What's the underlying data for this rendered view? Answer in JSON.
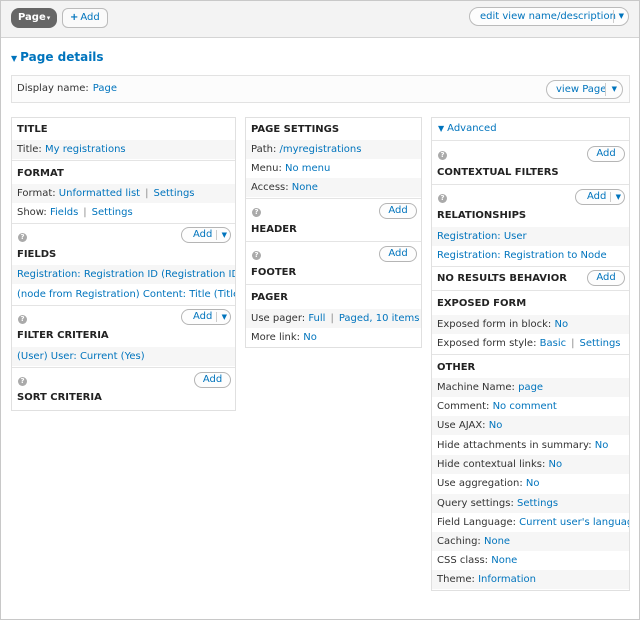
{
  "topbar": {
    "display_tab": "Page",
    "display_tab_caret": "▾",
    "add_display_icon": "+",
    "add_display": "Add",
    "edit_view_name": "edit view name/description",
    "dropdown_icon": "▼"
  },
  "details": {
    "toggle": "Page details",
    "toggle_icon": "▼",
    "display_name_label": "Display name:",
    "display_name_value": "Page",
    "view_page": "view Page"
  },
  "col1": {
    "title": {
      "heading": "TITLE",
      "label": "Title:",
      "value": "My registrations"
    },
    "format": {
      "heading": "FORMAT",
      "format_label": "Format:",
      "format_value": "Unformatted list",
      "format_settings": "Settings",
      "show_label": "Show:",
      "show_value": "Fields",
      "show_settings": "Settings"
    },
    "fields": {
      "heading": "FIELDS",
      "add": "Add",
      "items": [
        "Registration: Registration ID (Registration ID)",
        "(node from Registration) Content: Title (Title)"
      ]
    },
    "filter": {
      "heading": "FILTER CRITERIA",
      "add": "Add",
      "items": [
        "(User) User: Current (Yes)"
      ]
    },
    "sort": {
      "heading": "SORT CRITERIA",
      "add": "Add"
    }
  },
  "col2": {
    "page_settings": {
      "heading": "PAGE SETTINGS",
      "path_label": "Path:",
      "path_value": "/myregistrations",
      "menu_label": "Menu:",
      "menu_value": "No menu",
      "access_label": "Access:",
      "access_value": "None"
    },
    "header": {
      "heading": "HEADER",
      "add": "Add"
    },
    "footer": {
      "heading": "FOOTER",
      "add": "Add"
    },
    "pager": {
      "heading": "PAGER",
      "use_pager_label": "Use pager:",
      "use_pager_value": "Full",
      "use_pager_detail": "Paged, 10 items",
      "more_link_label": "More link:",
      "more_link_value": "No"
    }
  },
  "col3": {
    "advanced": "Advanced",
    "contextual": {
      "heading": "CONTEXTUAL FILTERS",
      "add": "Add"
    },
    "relationships": {
      "heading": "RELATIONSHIPS",
      "add": "Add",
      "items": [
        "Registration: User",
        "Registration: Registration to Node"
      ]
    },
    "no_results": {
      "heading": "NO RESULTS BEHAVIOR",
      "add": "Add"
    },
    "exposed": {
      "heading": "EXPOSED FORM",
      "in_block_label": "Exposed form in block:",
      "in_block_value": "No",
      "style_label": "Exposed form style:",
      "style_value": "Basic",
      "style_settings": "Settings"
    },
    "other": {
      "heading": "OTHER",
      "rows": [
        {
          "label": "Machine Name:",
          "value": "page"
        },
        {
          "label": "Comment:",
          "value": "No comment"
        },
        {
          "label": "Use AJAX:",
          "value": "No"
        },
        {
          "label": "Hide attachments in summary:",
          "value": "No"
        },
        {
          "label": "Hide contextual links:",
          "value": "No"
        },
        {
          "label": "Use aggregation:",
          "value": "No"
        },
        {
          "label": "Query settings:",
          "value": "Settings"
        },
        {
          "label": "Field Language:",
          "value": "Current user's language"
        },
        {
          "label": "Caching:",
          "value": "None"
        },
        {
          "label": "CSS class:",
          "value": "None"
        },
        {
          "label": "Theme:",
          "value": "Information"
        }
      ]
    }
  },
  "separator": "|",
  "colors": {
    "link": "#0074bd",
    "tab_bg": "#666666",
    "border": "#e0e0e0"
  }
}
